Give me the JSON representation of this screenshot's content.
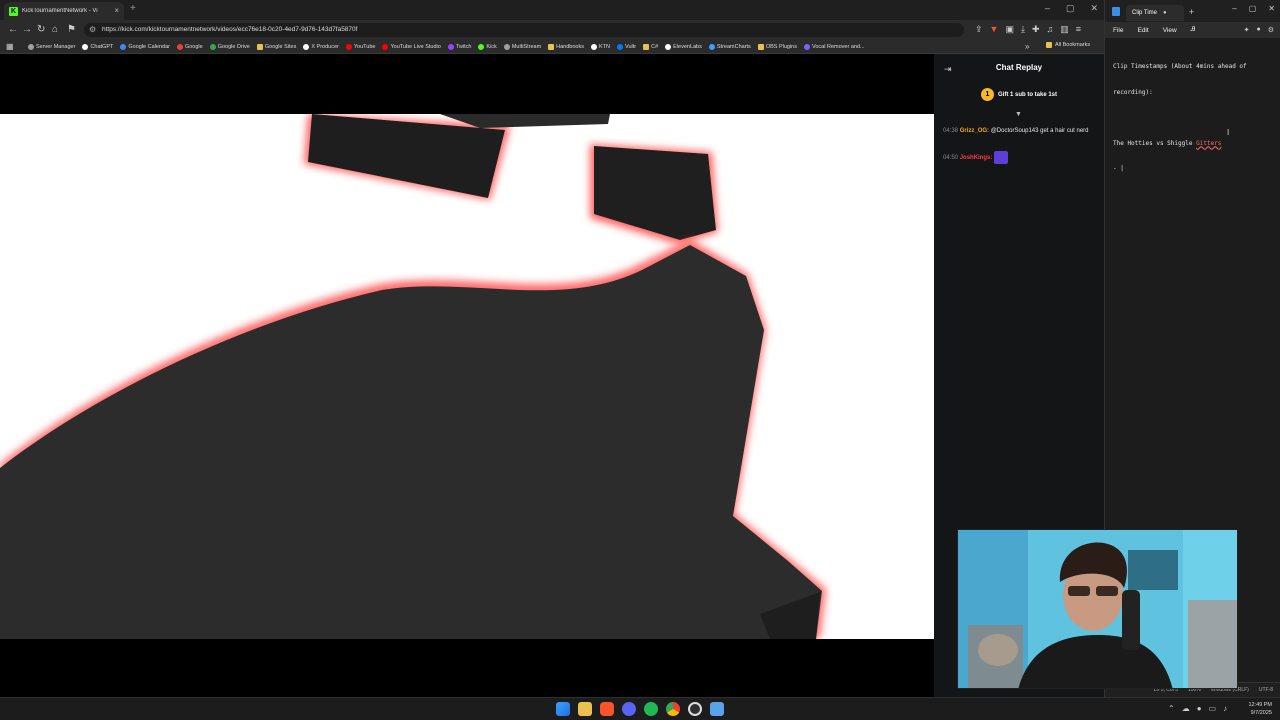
{
  "browser": {
    "tab_title": "KickTournamentNetwork - Vi",
    "url": "https://kick.com/kicktournamentnetwork/videos/ecc76e18-0c20-4ed7-9d76-143d7fa5870f",
    "bookmarks": [
      {
        "label": "Server Manager",
        "color": "#9aa0a6"
      },
      {
        "label": "ChatGPT",
        "color": "#ffffff"
      },
      {
        "label": "Google Calendar",
        "color": "#4285f4"
      },
      {
        "label": "Google",
        "color": "#ea4335"
      },
      {
        "label": "Google Drive",
        "color": "#34a853"
      },
      {
        "label": "Google Sites",
        "color": "#e8c14e",
        "folder": true
      },
      {
        "label": "X Producer",
        "color": "#ffffff"
      },
      {
        "label": "YouTube",
        "color": "#ff0000"
      },
      {
        "label": "YouTube Live Studio",
        "color": "#ff0000"
      },
      {
        "label": "Twitch",
        "color": "#9146ff"
      },
      {
        "label": "Kick",
        "color": "#53fc18"
      },
      {
        "label": "MultiStream",
        "color": "#9aa0a6"
      },
      {
        "label": "Handbooks",
        "color": "#e8c14e",
        "folder": true
      },
      {
        "label": "KTN",
        "color": "#ffffff"
      },
      {
        "label": "Vultr",
        "color": "#007bfc"
      },
      {
        "label": "C#",
        "color": "#e8c14e",
        "folder": true
      },
      {
        "label": "ElevenLabs",
        "color": "#ffffff"
      },
      {
        "label": "StreamCharts",
        "color": "#3aa0ff"
      },
      {
        "label": "OBS Plugins",
        "color": "#e8c14e",
        "folder": true
      },
      {
        "label": "Vocal Remover and...",
        "color": "#7b61ff"
      }
    ],
    "all_bookmarks_label": "All Bookmarks"
  },
  "chat": {
    "title": "Chat Replay",
    "gift_badge": "1",
    "gift_text": "Gift 1 sub to take 1st",
    "messages": [
      {
        "time": "04:38",
        "user": "Grizz_OG:",
        "text": " @DoctorSoup143 get a hair cut nerd"
      },
      {
        "time": "04:50",
        "user": "JoshKings:",
        "text": ""
      }
    ]
  },
  "notepad": {
    "tab_title": "Clip Time",
    "menus": [
      "File",
      "Edit",
      "View"
    ],
    "lines": [
      "Clip Timestamps (About 4mins ahead of",
      "recording):",
      "",
      "The Hotties vs Shiggle Gitters",
      "- |"
    ],
    "status": [
      "Ln 5, Col 3",
      "100%",
      "Windows (CRLF)",
      "UTF-8"
    ]
  },
  "taskbar": {
    "time": "12:49 PM",
    "date": "9/7/2025"
  },
  "colors": {
    "kick_green": "#53fc18",
    "chat_bg": "#141517",
    "gift_gold": "#f5b92d"
  }
}
